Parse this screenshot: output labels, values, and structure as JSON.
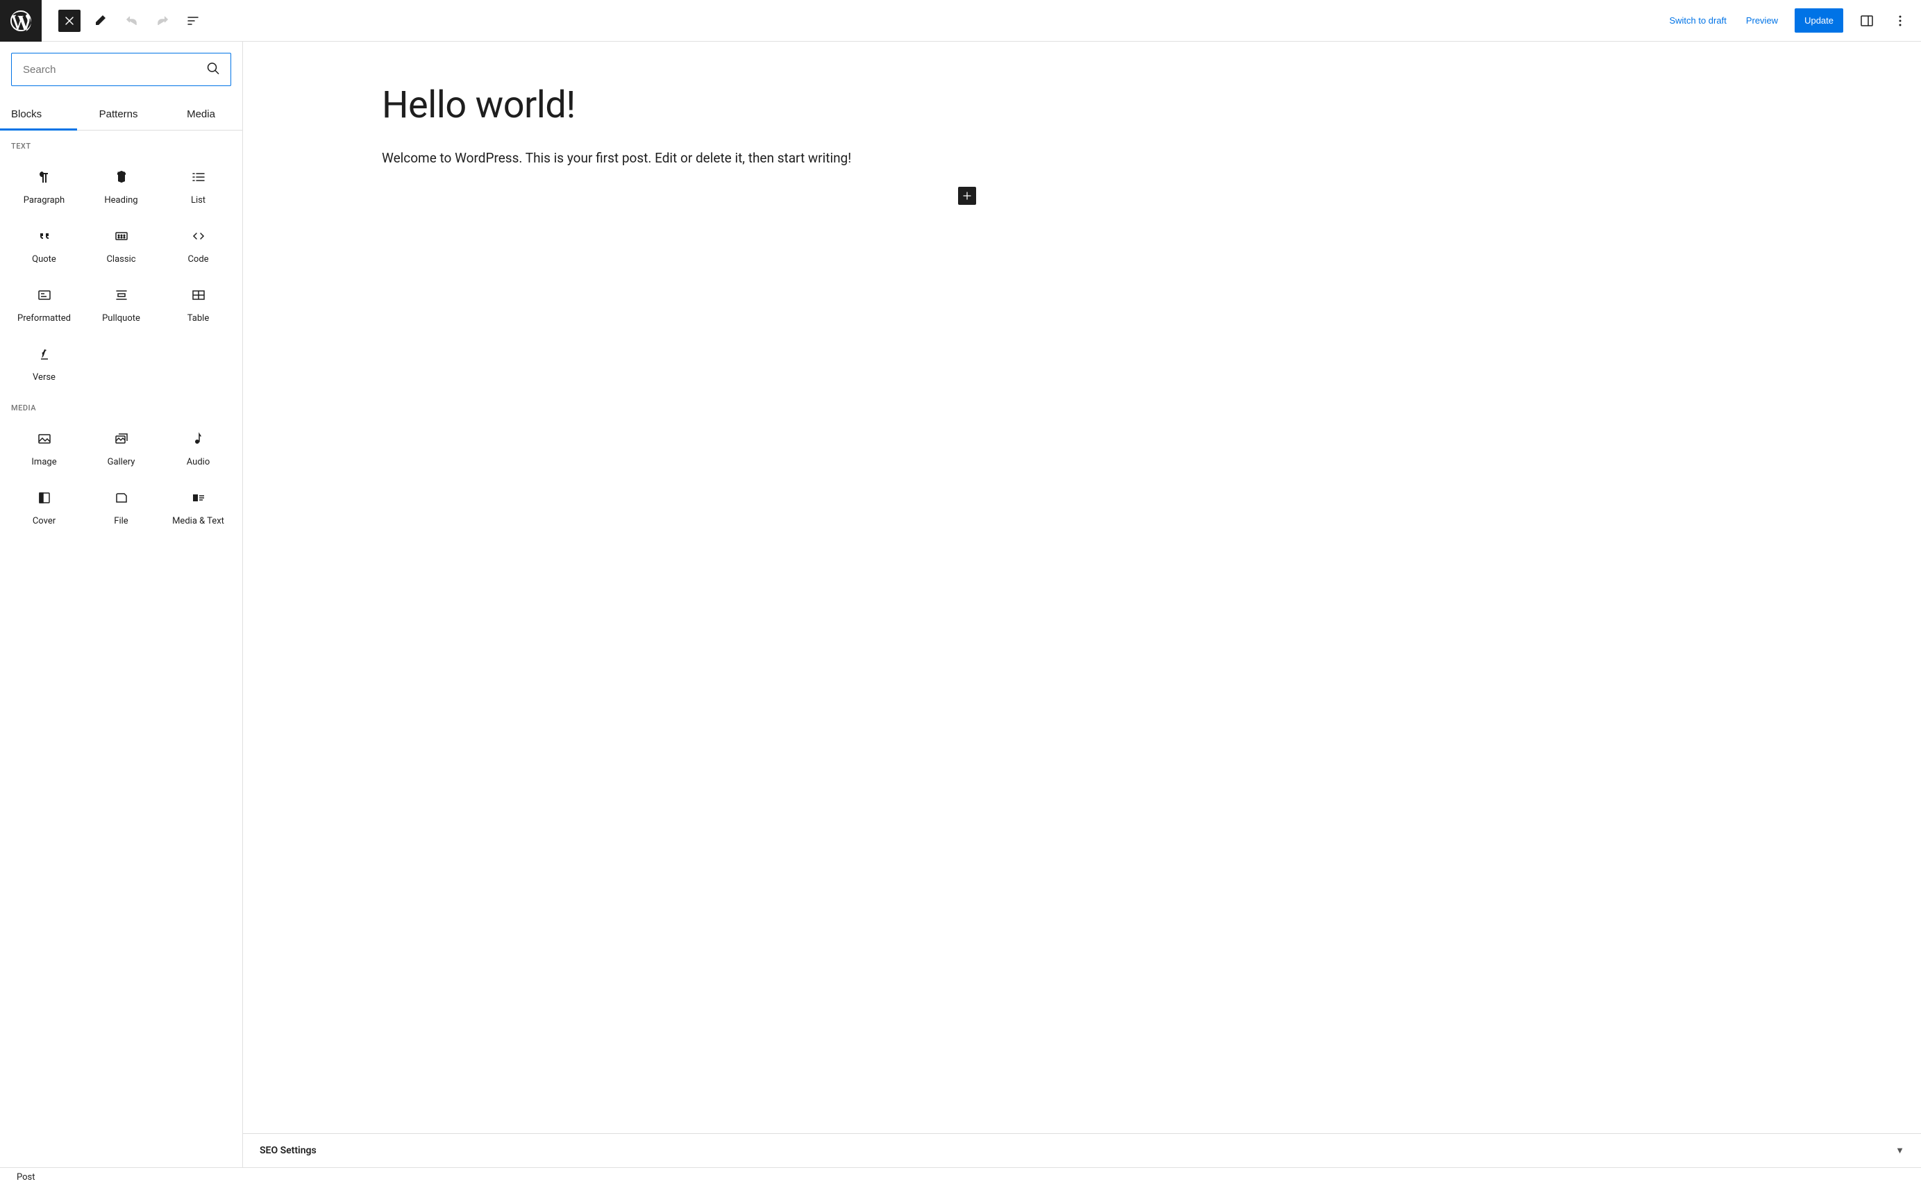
{
  "header": {
    "switchDraft": "Switch to draft",
    "preview": "Preview",
    "update": "Update"
  },
  "inserter": {
    "searchPlaceholder": "Search",
    "tabs": {
      "blocks": "Blocks",
      "patterns": "Patterns",
      "media": "Media"
    },
    "categories": {
      "text": "TEXT",
      "media": "MEDIA"
    },
    "blocks": {
      "text": [
        {
          "id": "paragraph",
          "label": "Paragraph"
        },
        {
          "id": "heading",
          "label": "Heading"
        },
        {
          "id": "list",
          "label": "List"
        },
        {
          "id": "quote",
          "label": "Quote"
        },
        {
          "id": "classic",
          "label": "Classic"
        },
        {
          "id": "code",
          "label": "Code"
        },
        {
          "id": "preformatted",
          "label": "Preformatted"
        },
        {
          "id": "pullquote",
          "label": "Pullquote"
        },
        {
          "id": "table",
          "label": "Table"
        },
        {
          "id": "verse",
          "label": "Verse"
        }
      ],
      "media": [
        {
          "id": "image",
          "label": "Image"
        },
        {
          "id": "gallery",
          "label": "Gallery"
        },
        {
          "id": "audio",
          "label": "Audio"
        },
        {
          "id": "cover",
          "label": "Cover"
        },
        {
          "id": "file",
          "label": "File"
        },
        {
          "id": "mediatext",
          "label": "Media & Text"
        }
      ]
    }
  },
  "editor": {
    "title": "Hello world!",
    "paragraph": "Welcome to WordPress. This is your first post. Edit or delete it, then start writing!"
  },
  "metabox": {
    "title": "SEO Settings"
  },
  "footer": {
    "breadcrumb": "Post"
  }
}
